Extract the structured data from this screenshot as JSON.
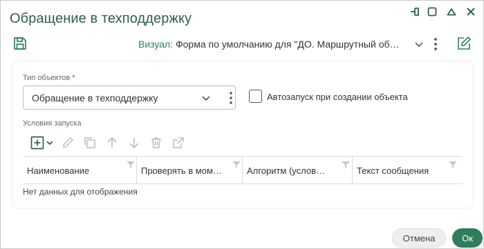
{
  "window": {
    "title": "Обращение в техподдержку"
  },
  "toolbar": {
    "visual_label": "Визуал:",
    "visual_value": "Форма по умолчанию для \"ДО. Маршрутный об…"
  },
  "form": {
    "object_type_label": "Тип объектов *",
    "object_type_value": "Обращение в техподдержку",
    "autostart_label": "Автозапуск при создании объекта",
    "autostart_checked": false,
    "conditions_label": "Условия запуска"
  },
  "grid": {
    "columns": [
      {
        "label": "Наименование"
      },
      {
        "label": "Проверять в мом…"
      },
      {
        "label": "Алгоритм (услов…"
      },
      {
        "label": "Текст сообщения"
      }
    ],
    "empty_text": "Нет данных для отображения"
  },
  "footer": {
    "cancel_label": "Отмена",
    "ok_label": "Ок"
  },
  "colors": {
    "accent": "#2e7d5b",
    "title": "#2e5f4a"
  }
}
